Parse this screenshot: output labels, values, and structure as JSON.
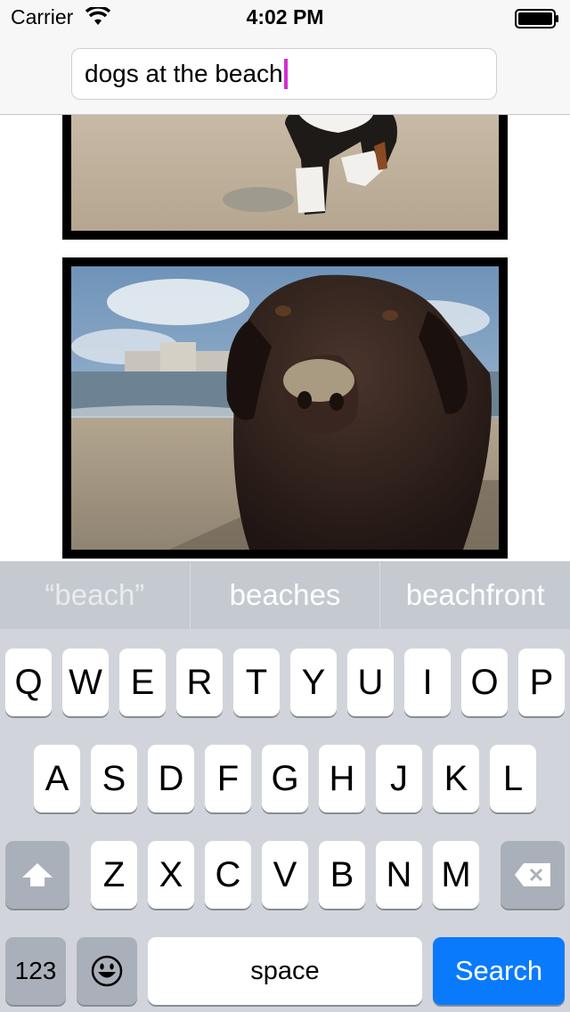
{
  "status_bar": {
    "carrier": "Carrier",
    "time": "4:02 PM"
  },
  "search": {
    "value": "dogs at the beach"
  },
  "results": [
    {
      "label": "dog-walking-on-sand"
    },
    {
      "label": "dog-with-sandy-nose-on-beach"
    }
  ],
  "suggestions": [
    "“beach”",
    "beaches",
    "beachfront"
  ],
  "keyboard": {
    "row1": [
      "Q",
      "W",
      "E",
      "R",
      "T",
      "Y",
      "U",
      "I",
      "O",
      "P"
    ],
    "row2": [
      "A",
      "S",
      "D",
      "F",
      "G",
      "H",
      "J",
      "K",
      "L"
    ],
    "row3": [
      "Z",
      "X",
      "C",
      "V",
      "B",
      "N",
      "M"
    ],
    "numbers_label": "123",
    "space_label": "space",
    "search_label": "Search"
  },
  "colors": {
    "accent": "#0a7afd",
    "caret": "#d42ed0"
  }
}
